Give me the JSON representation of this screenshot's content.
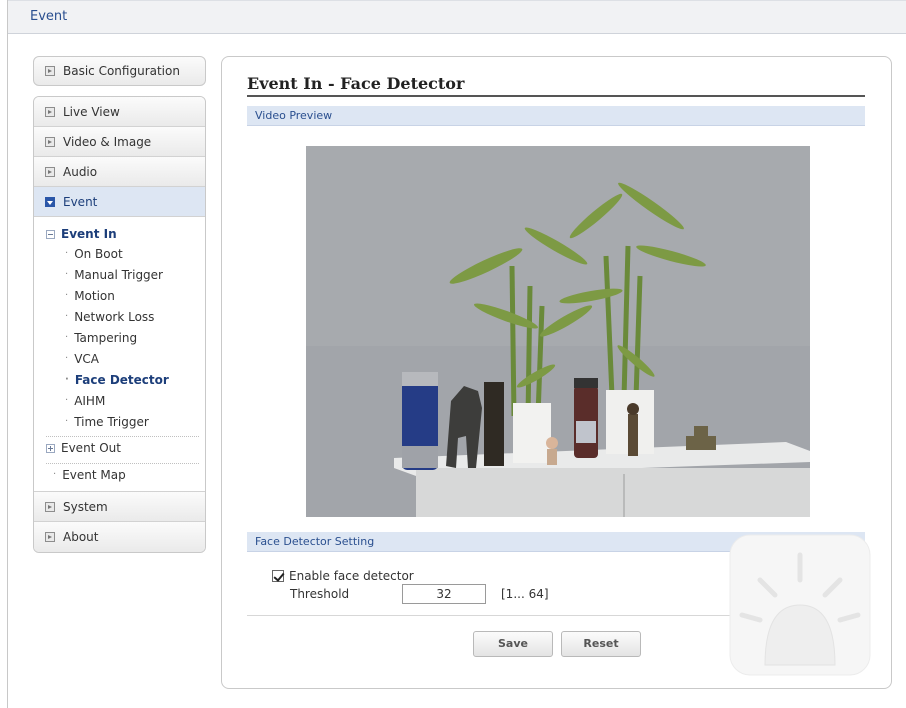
{
  "window": {
    "title": "Event"
  },
  "sidebar": {
    "basic_configuration": "Basic Configuration",
    "items": [
      {
        "label": "Live View"
      },
      {
        "label": "Video & Image"
      },
      {
        "label": "Audio"
      },
      {
        "label": "Event"
      },
      {
        "label": "System"
      },
      {
        "label": "About"
      }
    ],
    "event_tree": {
      "event_in": "Event In",
      "event_in_children": [
        "On Boot",
        "Manual Trigger",
        "Motion",
        "Network Loss",
        "Tampering",
        "VCA",
        "Face Detector",
        "AIHM",
        "Time Trigger"
      ],
      "current": "Face Detector",
      "event_out": "Event Out",
      "event_map": "Event Map"
    }
  },
  "main": {
    "title": "Event In - Face Detector",
    "video_preview_header": "Video Preview",
    "settings_header": "Face Detector Setting",
    "enable_label": "Enable face detector",
    "enable_checked": true,
    "threshold_label": "Threshold",
    "threshold_value": "32",
    "threshold_range": "[1... 64]",
    "save_label": "Save",
    "reset_label": "Reset"
  }
}
